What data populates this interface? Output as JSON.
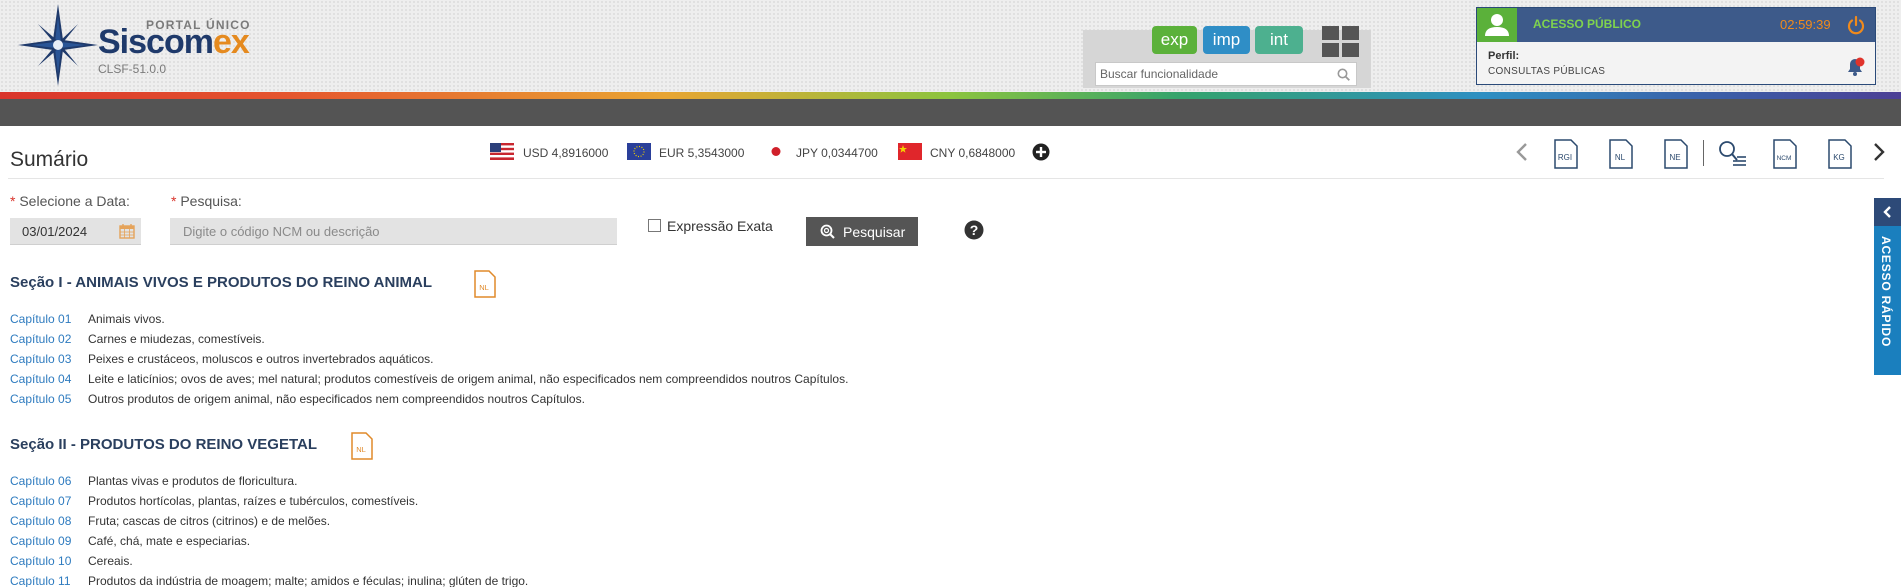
{
  "header": {
    "portal_label": "PORTAL ÚNICO",
    "brand_part1": "Siscom",
    "brand_part2": "ex",
    "version": "CLSF-51.0.0",
    "modules": [
      {
        "label": "exp",
        "color": "#5bb13a"
      },
      {
        "label": "imp",
        "color": "#2f8ec6"
      },
      {
        "label": "int",
        "color": "#4db08f"
      }
    ],
    "search_placeholder": "Buscar funcionalidade",
    "user": {
      "title": "ACESSO PÚBLICO",
      "timer": "02:59:39",
      "profile_label": "Perfil:",
      "profile_value": "CONSULTAS PÚBLICAS"
    }
  },
  "page": {
    "title": "Sumário"
  },
  "currencies": [
    {
      "code": "USD",
      "value": "USD 4,8916000",
      "flag": "us-flag"
    },
    {
      "code": "EUR",
      "value": "EUR 5,3543000",
      "flag": "eu-flag"
    },
    {
      "code": "JPY",
      "value": "JPY 0,0344700",
      "flag": "jp-flag"
    },
    {
      "code": "CNY",
      "value": "CNY 0,6848000",
      "flag": "cn-flag"
    }
  ],
  "toolbar": {
    "icons": [
      "RGI",
      "NL",
      "NE",
      "NCM",
      "KG"
    ]
  },
  "form": {
    "date_label": "Selecione a Data:",
    "date_value": "03/01/2024",
    "search_label": "Pesquisa:",
    "search_placeholder": "Digite o código NCM ou descrição",
    "exact_label": "Expressão Exata",
    "search_button": "Pesquisar",
    "required_mark": "*"
  },
  "sections": [
    {
      "title": "Seção I - ANIMAIS VIVOS E PRODUTOS DO REINO ANIMAL",
      "chapters": [
        {
          "label": "Capítulo 01",
          "desc": "Animais vivos."
        },
        {
          "label": "Capítulo 02",
          "desc": "Carnes e miudezas, comestíveis."
        },
        {
          "label": "Capítulo 03",
          "desc": "Peixes e crustáceos, moluscos e outros invertebrados aquáticos."
        },
        {
          "label": "Capítulo 04",
          "desc": "Leite e laticínios; ovos de aves; mel natural; produtos comestíveis de origem animal, não especificados nem compreendidos noutros Capítulos."
        },
        {
          "label": "Capítulo 05",
          "desc": "Outros produtos de origem animal, não especificados nem compreendidos noutros Capítulos."
        }
      ]
    },
    {
      "title": "Seção II - PRODUTOS DO REINO VEGETAL",
      "chapters": [
        {
          "label": "Capítulo 06",
          "desc": "Plantas vivas e produtos de floricultura."
        },
        {
          "label": "Capítulo 07",
          "desc": "Produtos hortícolas, plantas, raízes e tubérculos, comestíveis."
        },
        {
          "label": "Capítulo 08",
          "desc": "Fruta; cascas de citros (citrinos) e de melões."
        },
        {
          "label": "Capítulo 09",
          "desc": "Café, chá, mate e especiarias."
        },
        {
          "label": "Capítulo 10",
          "desc": "Cereais."
        },
        {
          "label": "Capítulo 11",
          "desc": "Produtos da indústria de moagem; malte; amidos e féculas; inulina; glúten de trigo."
        }
      ]
    }
  ],
  "side_tab": {
    "label": "ACESSO RÁPIDO"
  }
}
